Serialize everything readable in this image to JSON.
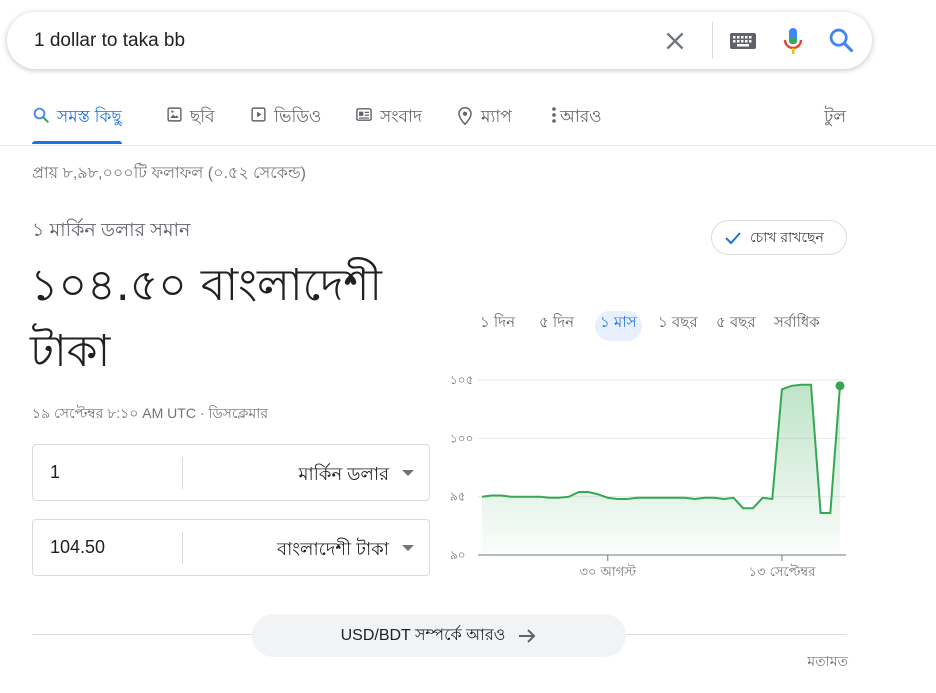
{
  "search": {
    "query": "1 dollar to taka bb",
    "icons": [
      "close-icon",
      "keyboard-icon",
      "mic-icon",
      "search-icon"
    ]
  },
  "tabs": [
    {
      "label": "সমস্ত কিছু",
      "icon": "search-icon",
      "active": true
    },
    {
      "label": "ছবি",
      "icon": "image-icon"
    },
    {
      "label": "ভিডিও",
      "icon": "play-icon"
    },
    {
      "label": "সংবাদ",
      "icon": "news-icon"
    },
    {
      "label": "ম্যাপ",
      "icon": "pin-icon"
    },
    {
      "label": "আরও",
      "icon": "more-vert-icon"
    }
  ],
  "tools_label": "টুল",
  "result_stats": "প্রায় ৮,৯৮,০০০টি ফলাফল (০.৫২ সেকেন্ড)",
  "converter": {
    "equals_label": "১ মার্কিন ডলার সমান",
    "result_value": "১০৪.৫০ বাংলাদেশী টাকা",
    "updated_text": "১৯ সেপ্টেম্বর ৮:১০ AM UTC · ",
    "disclaimer": "ডিসক্লেমার",
    "from": {
      "amount": "1",
      "unit": "মার্কিন ডলার"
    },
    "to": {
      "amount": "104.50",
      "unit": "বাংলাদেশী টাকা"
    },
    "track_label": "চোখ রাখছেন"
  },
  "ranges": [
    {
      "label": "১ দিন"
    },
    {
      "label": "৫ দিন"
    },
    {
      "label": "১ মাস",
      "active": true
    },
    {
      "label": "১ বছর"
    },
    {
      "label": "৫ বছর"
    },
    {
      "label": "সর্বাধিক"
    }
  ],
  "chart_data": {
    "type": "area",
    "color": "#34a853",
    "ylim": [
      90,
      105
    ],
    "yticks": [
      {
        "value": 105,
        "label": "১০৫"
      },
      {
        "value": 100,
        "label": "১০০"
      },
      {
        "value": 95,
        "label": "৯৫"
      },
      {
        "value": 90,
        "label": "৯০"
      }
    ],
    "xticks": [
      {
        "index": 13,
        "label": "৩০ আগস্ট"
      },
      {
        "index": 31,
        "label": "১৩ সেপ্টেম্বর"
      }
    ],
    "values": [
      95.0,
      95.1,
      95.1,
      95.0,
      95.0,
      95.0,
      95.0,
      94.9,
      94.9,
      95.0,
      95.4,
      95.4,
      95.2,
      94.9,
      94.8,
      94.8,
      94.9,
      94.9,
      94.9,
      94.9,
      94.9,
      94.9,
      94.8,
      94.9,
      94.9,
      94.8,
      94.9,
      94.0,
      94.0,
      94.9,
      94.8,
      104.2,
      104.5,
      104.6,
      104.6,
      93.6,
      93.6,
      104.5
    ]
  },
  "more_label": "USD/BDT সম্পর্কে আরও",
  "feedback_label": "মতামত"
}
